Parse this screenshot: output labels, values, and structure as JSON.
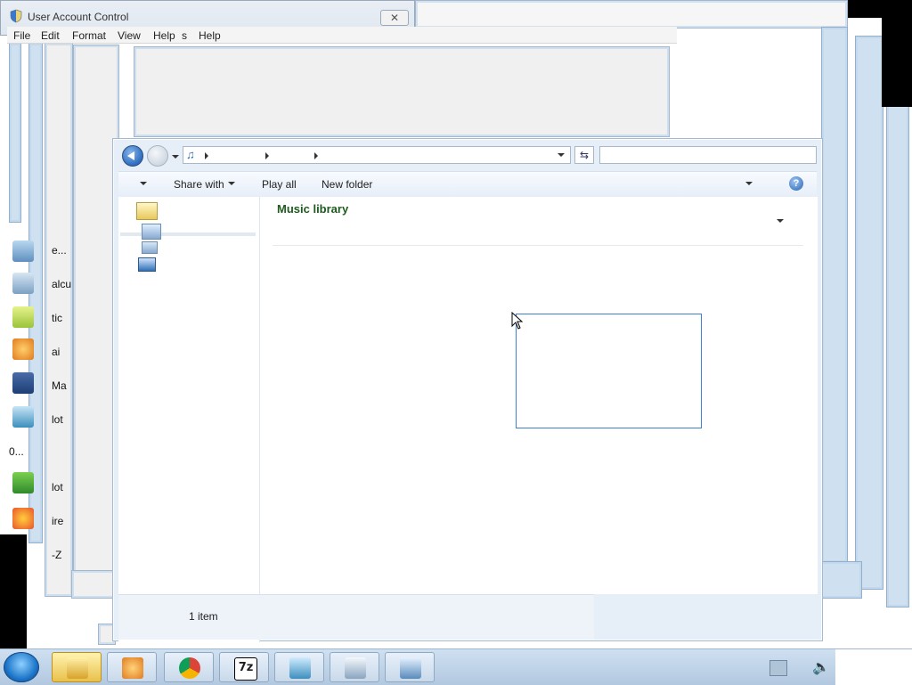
{
  "uac_window": {
    "title": "User Account Control"
  },
  "menubar": {
    "items": [
      "File",
      "Edit",
      "Format",
      "View",
      "Help",
      "s",
      "Help"
    ]
  },
  "explorer": {
    "toolbar": {
      "share_with": "Share with",
      "play_all": "Play all",
      "new_folder": "New folder"
    },
    "library_title": "Music library",
    "status": "1 item"
  },
  "desktop_fragments": [
    "e...",
    "alcu",
    "tic",
    "ai",
    "Ma",
    "lot",
    "0...",
    "lot",
    "ire",
    "-Z"
  ],
  "taskbar": {
    "buttons": [
      "start-orb",
      "windows-explorer",
      "media-player",
      "chrome",
      "7zip",
      "notepad",
      "app-window-1",
      "app-window-2"
    ]
  }
}
